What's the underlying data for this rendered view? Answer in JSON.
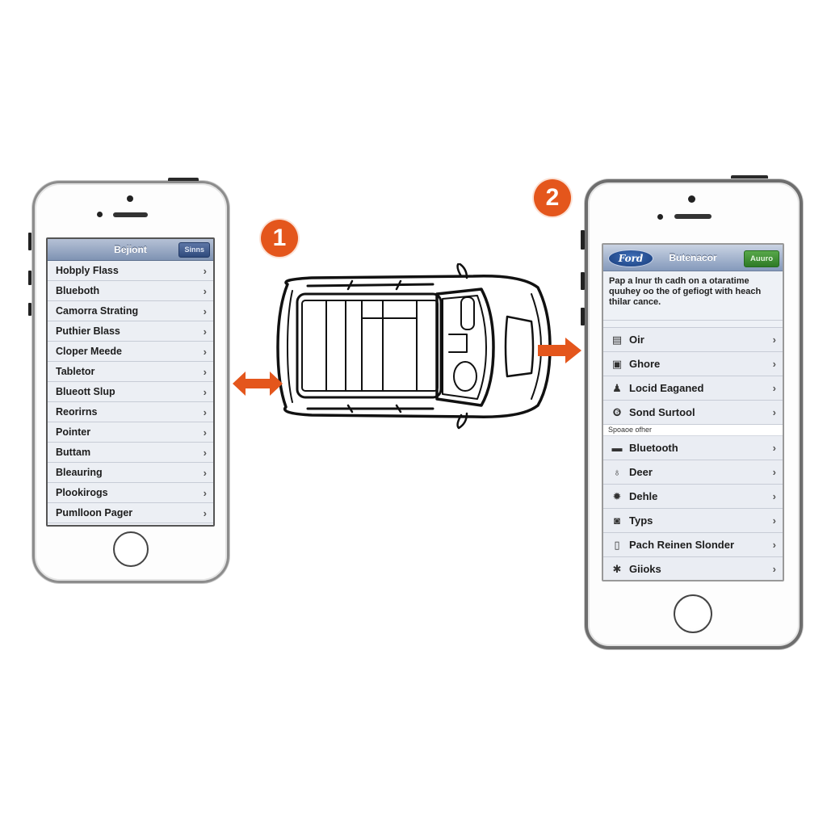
{
  "badges": {
    "step1": "1",
    "step2": "2"
  },
  "accent_color": "#e4561c",
  "left_phone": {
    "navbar": {
      "title": "Bejiont",
      "button": "Sinns"
    },
    "items": [
      {
        "label": "Hobply Flass"
      },
      {
        "label": "Blueboth"
      },
      {
        "label": "Camorra Strating"
      },
      {
        "label": "Puthier Blass"
      },
      {
        "label": "Cloper Meede"
      },
      {
        "label": "Tabletor"
      },
      {
        "label": "Blueott Slup"
      },
      {
        "label": "Reorirns"
      },
      {
        "label": "Pointer"
      },
      {
        "label": "Buttam"
      },
      {
        "label": "Bleauring"
      },
      {
        "label": "Plookirogs"
      },
      {
        "label": "Pumlloon Pager"
      }
    ],
    "chevron": "›"
  },
  "right_phone": {
    "navbar": {
      "logo": "Ford",
      "title": "Butenacor",
      "button": "Auuro"
    },
    "description": "Pap a lnur th cadh on a otaratime quuhey oo the of gefiogt with heach thilar cance.",
    "items_top": [
      {
        "icon": "sim-card-icon",
        "glyph": "▤",
        "label": "Oir"
      },
      {
        "icon": "tv-icon",
        "glyph": "▣",
        "label": "Ghore"
      },
      {
        "icon": "person-icon",
        "glyph": "♟",
        "label": "Locid Eaganed"
      },
      {
        "icon": "lock-icon",
        "glyph": "❻",
        "label": "Sond Surtool"
      }
    ],
    "section_header": "Spoaoe ofher",
    "items_bottom": [
      {
        "icon": "dash-icon",
        "glyph": "▬",
        "label": "Bluetooth"
      },
      {
        "icon": "location-pin-icon",
        "glyph": "♁",
        "label": "Deer"
      },
      {
        "icon": "gear-icon",
        "glyph": "✹",
        "label": "Dehle"
      },
      {
        "icon": "chat-bubble-icon",
        "glyph": "◙",
        "label": "Typs"
      },
      {
        "icon": "trash-icon",
        "glyph": "▯",
        "label": "Pach Reinen Slonder"
      },
      {
        "icon": "asterisk-icon",
        "glyph": "✱",
        "label": "Giioks"
      }
    ],
    "chevron": "›"
  }
}
